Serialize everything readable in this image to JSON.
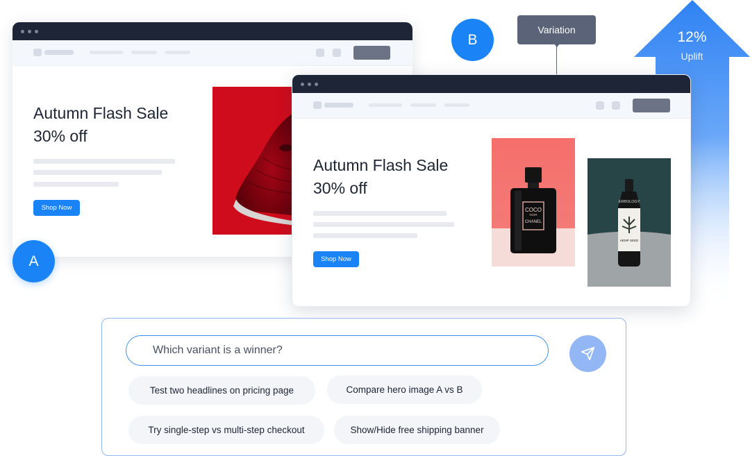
{
  "uplift": {
    "percent": "12%",
    "label": "Uplift",
    "icon": "arrow-up-icon"
  },
  "variant_a": {
    "badge": "A",
    "headline_line1": "Autumn Flash Sale",
    "headline_line2": "30% off",
    "cta": "Shop Now",
    "image": "red-sneaker-image"
  },
  "variant_b": {
    "badge": "B",
    "headline_line1": "Autumn Flash Sale",
    "headline_line2": "30% off",
    "cta": "Shop Now",
    "images": [
      "perfume-bottle-image",
      "hemp-seed-bottle-image"
    ],
    "perfume_label": {
      "brand": "COCO",
      "sub": "NOIR",
      "maker": "CHANEL"
    },
    "bottle_label": {
      "brand": "ERBOLOGY",
      "product": "HEMP SEED"
    }
  },
  "tooltip": {
    "label": "Variation"
  },
  "chat": {
    "placeholder": "Which variant is a winner?",
    "send_icon": "send-icon",
    "suggestions": [
      "Test two headlines on pricing page",
      "Compare hero image A vs B",
      "Try single-step vs multi-step checkout",
      "Show/Hide free shipping banner"
    ]
  },
  "colors": {
    "accent": "#1a84f7",
    "titlebar": "#1e2536",
    "tooltip": "#5a6377",
    "send": "#93b6f5"
  }
}
